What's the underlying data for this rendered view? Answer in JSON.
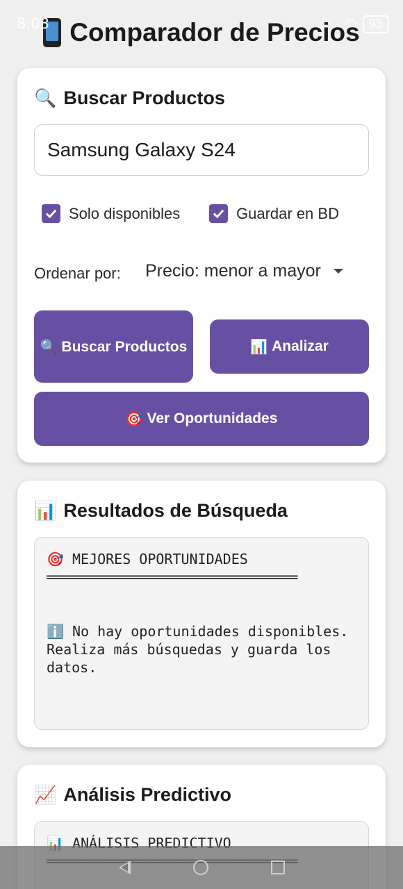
{
  "status_bar": {
    "time": "8:03",
    "battery": "95"
  },
  "app": {
    "title": "Comparador de Precios"
  },
  "search_card": {
    "title": "Buscar Productos",
    "search_value": "Samsung Galaxy S24",
    "only_available_label": "Solo disponibles",
    "only_available_checked": true,
    "save_db_label": "Guardar en BD",
    "save_db_checked": true,
    "sort_label": "Ordenar por:",
    "sort_value": "Precio: menor a mayor",
    "search_button": "Buscar Productos",
    "analyze_button": "Analizar",
    "opportunities_button": "Ver Oportunidades"
  },
  "results_card": {
    "title": "Resultados de Búsqueda",
    "text": "🎯 MEJORES OPORTUNIDADES\n══════════════════════════════\n\n\nℹ️ No hay oportunidades disponibles.\nRealiza más búsquedas y guarda los datos."
  },
  "predictive_card": {
    "title": "Análisis Predictivo",
    "text": "📊 ANÁLISIS PREDICTIVO\n══════════════════════════════"
  },
  "colors": {
    "primary": "#6750a4",
    "background": "#efefef",
    "card": "#ffffff"
  }
}
